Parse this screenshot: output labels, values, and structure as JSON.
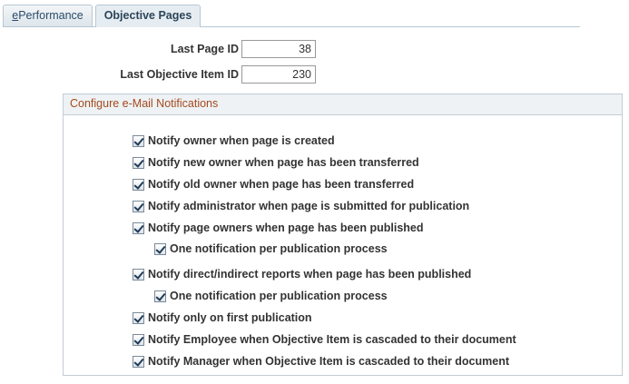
{
  "tabs": [
    {
      "label_access": "e",
      "label_rest": "Performance",
      "active": false
    },
    {
      "label": "Objective Pages",
      "active": true
    }
  ],
  "fields": {
    "last_page_id": {
      "label": "Last Page ID",
      "value": "38"
    },
    "last_objective_item_id": {
      "label": "Last Objective Item ID",
      "value": "230"
    }
  },
  "group": {
    "title": "Configure e-Mail Notifications",
    "checkboxes": [
      {
        "label": "Notify owner when page is created",
        "checked": true
      },
      {
        "label": "Notify new owner when page has been transferred",
        "checked": true
      },
      {
        "label": "Notify old owner when page has been transferred",
        "checked": true
      },
      {
        "label": "Notify administrator when page is submitted for publication",
        "checked": true
      },
      {
        "label": "Notify page owners when page has been published",
        "checked": true
      },
      {
        "label": "One notification per publication process",
        "checked": true
      },
      {
        "label": "Notify direct/indirect reports when page has been published",
        "checked": true
      },
      {
        "label": "One notification per publication process",
        "checked": true
      },
      {
        "label": "Notify only on first publication",
        "checked": true
      },
      {
        "label": "Notify Employee when Objective Item is cascaded to their document",
        "checked": true
      },
      {
        "label": "Notify Manager when Objective Item is cascaded to their document",
        "checked": true
      }
    ]
  }
}
